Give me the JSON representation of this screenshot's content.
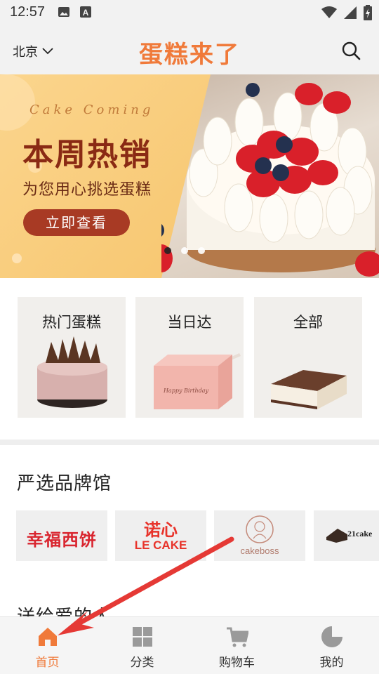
{
  "status_bar": {
    "time": "12:57",
    "icons_left": [
      "image-icon",
      "a-icon"
    ],
    "icons_right": [
      "wifi-icon",
      "signal-icon",
      "battery-icon"
    ]
  },
  "header": {
    "city": "北京",
    "title": "蛋糕来了",
    "search_icon": "search-icon"
  },
  "banner": {
    "subtitle_en": "Cake Coming",
    "title": "本周热销",
    "subtitle": "为您用心挑选蛋糕",
    "button_label": "立即查看",
    "dots": 3,
    "active_dot": 0
  },
  "categories": [
    {
      "label": "热门蛋糕"
    },
    {
      "label": "当日达"
    },
    {
      "label": "全部"
    }
  ],
  "brands": {
    "title": "严选品牌馆",
    "items": [
      {
        "name": "幸福西饼"
      },
      {
        "name": "诺心",
        "sub": "LE CAKE"
      },
      {
        "name": "cakeboss"
      },
      {
        "name": "21cake"
      }
    ]
  },
  "next_section_title": "送给爱的人",
  "bottom_nav": {
    "items": [
      {
        "label": "首页",
        "icon": "home-icon",
        "active": true
      },
      {
        "label": "分类",
        "icon": "grid-icon",
        "active": false
      },
      {
        "label": "购物车",
        "icon": "cart-icon",
        "active": false
      },
      {
        "label": "我的",
        "icon": "profile-icon",
        "active": false
      }
    ]
  },
  "colors": {
    "accent": "#f07a3a",
    "banner_button": "#a83a24",
    "annotation_arrow": "#e53935"
  }
}
